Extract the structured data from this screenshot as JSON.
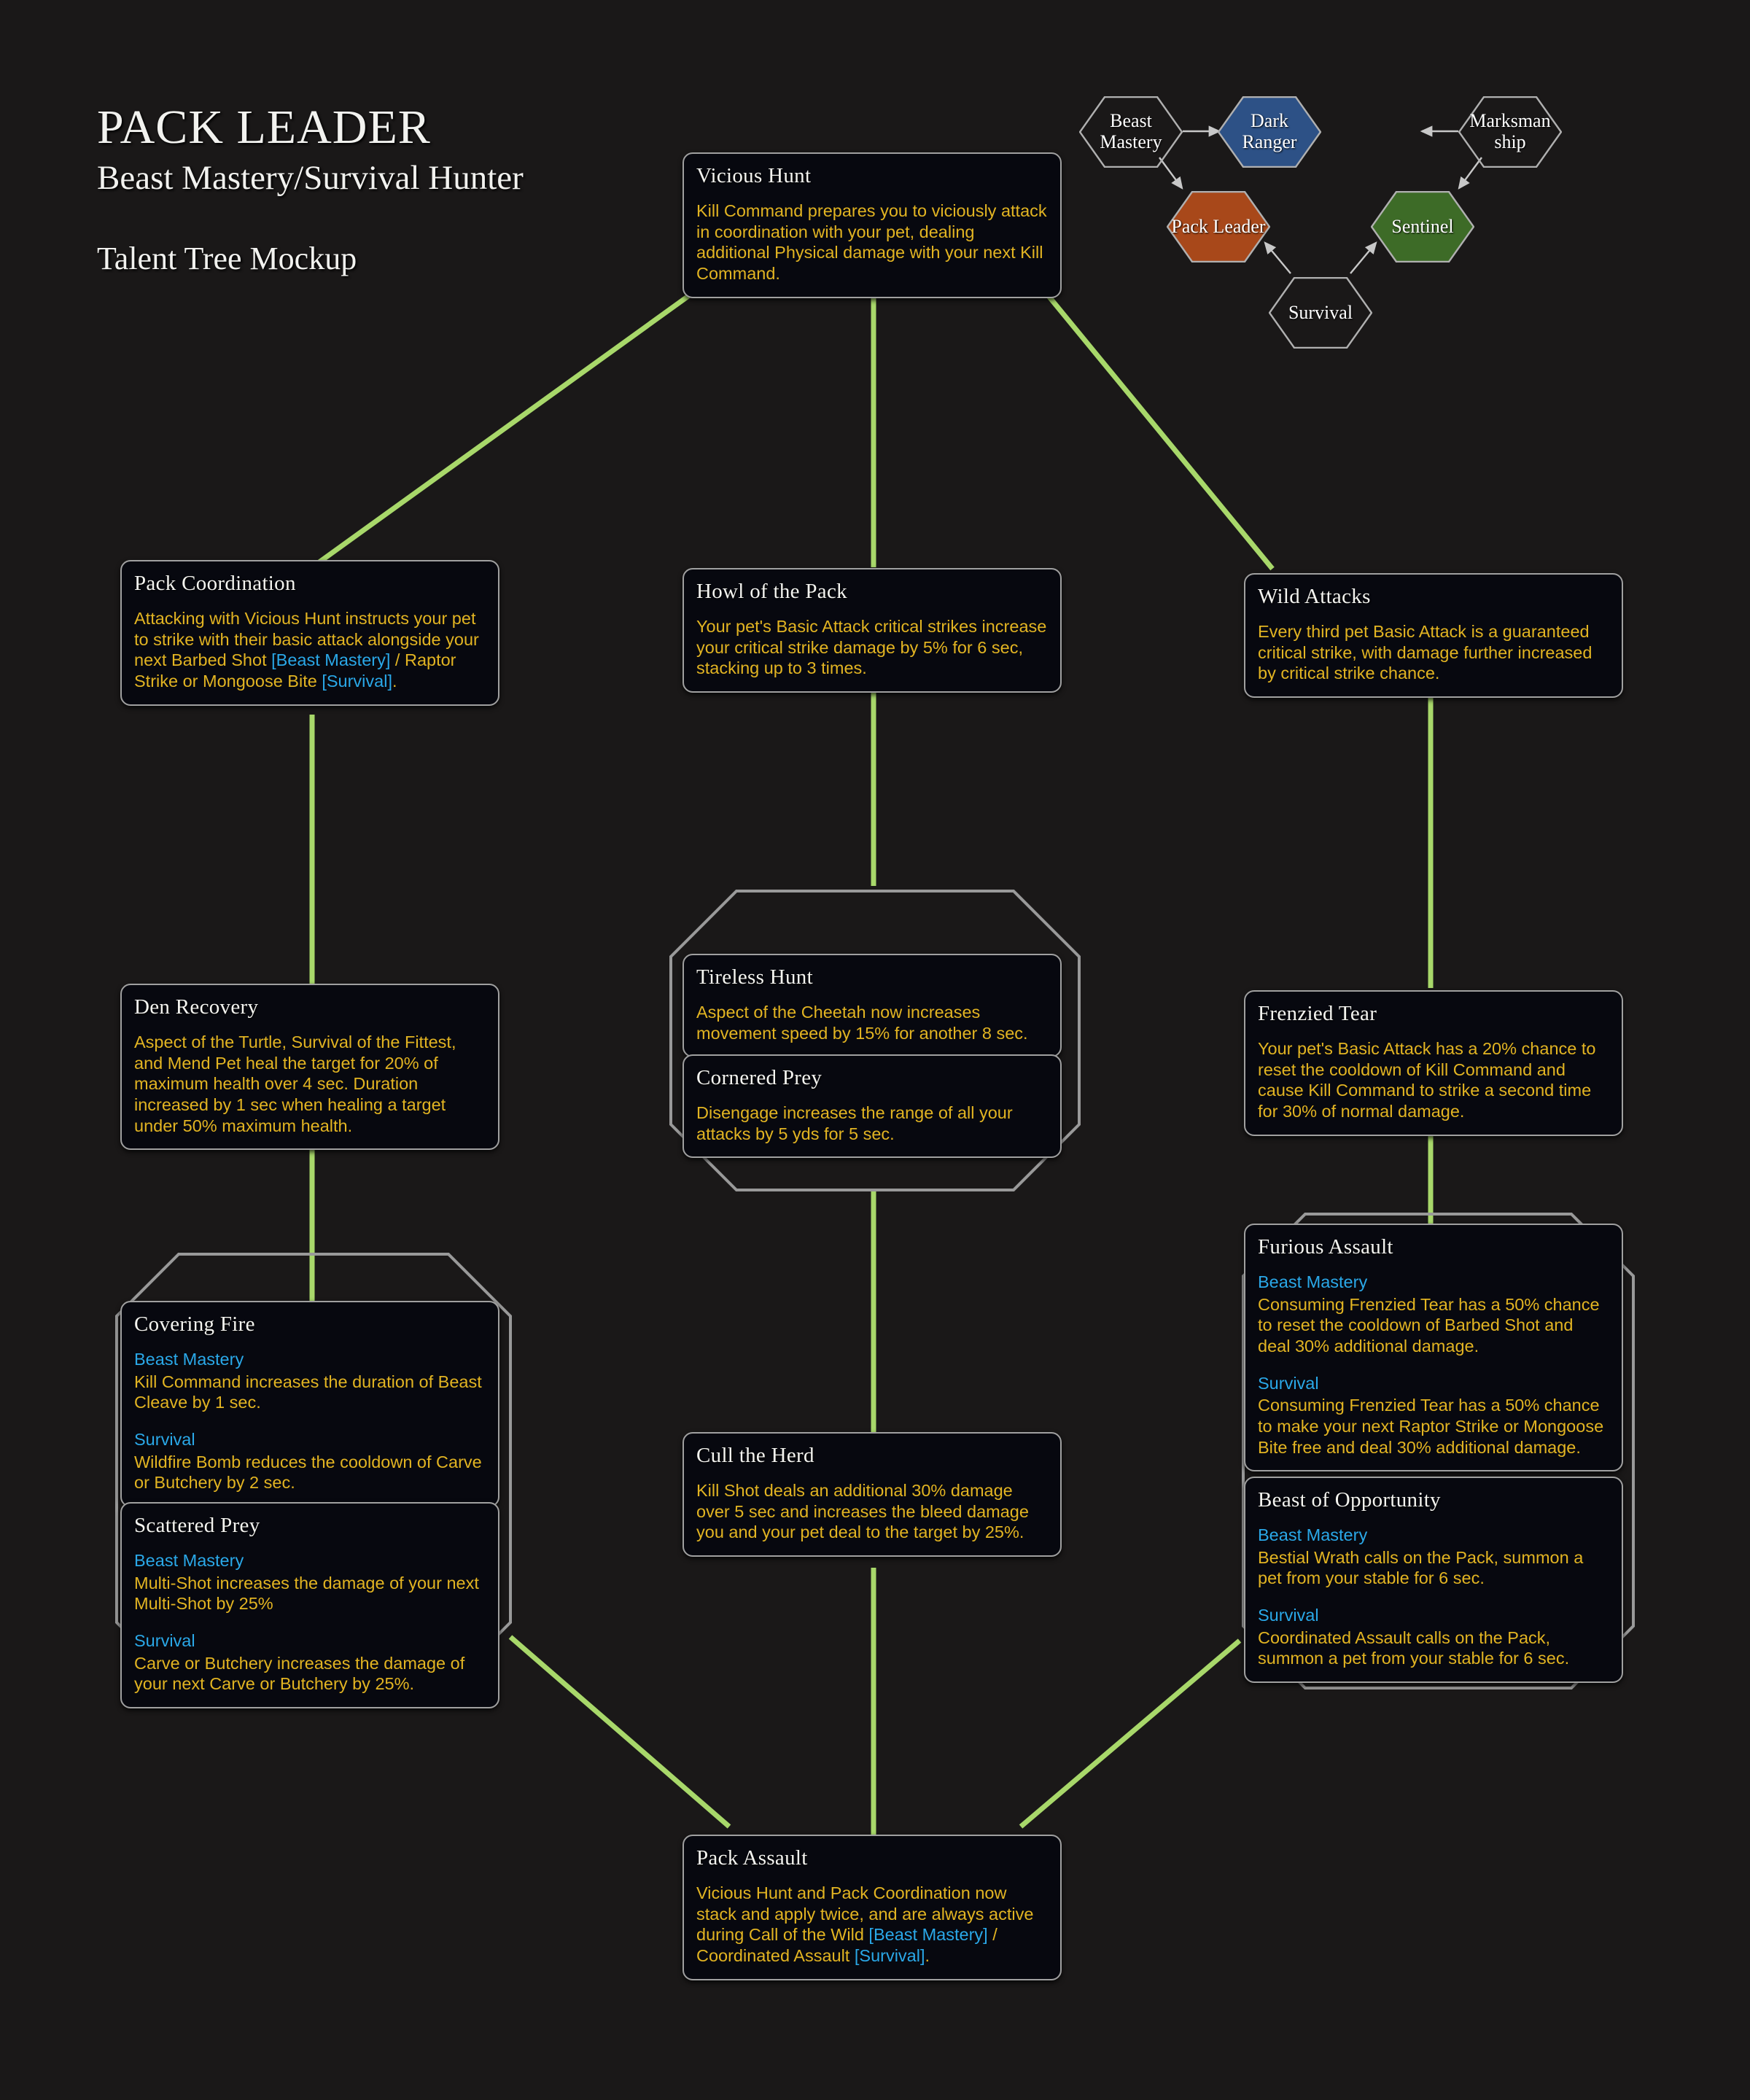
{
  "header": {
    "title": "PACK LEADER",
    "subtitle": "Beast Mastery/Survival Hunter",
    "caption": "Talent Tree Mockup"
  },
  "colors": {
    "background": "#1a1818",
    "node_bg": "#07080f",
    "node_border": "#a0a0a0",
    "connector": "#a8d86a",
    "desc_text": "#e2b422",
    "spec_text": "#2aa8e8",
    "title_text": "#f4f4f0",
    "hex_dark_ranger": "#2d5186",
    "hex_pack_leader": "#a8481a",
    "hex_sentinel": "#3d6b27",
    "hex_outline": "#b0b0b0"
  },
  "spec_map": {
    "nodes": [
      {
        "id": "beast-mastery",
        "label": "Beast Mastery",
        "fill": "none"
      },
      {
        "id": "dark-ranger",
        "label": "Dark Ranger",
        "fill": "#2d5186"
      },
      {
        "id": "marksmanship",
        "label": "Marksman ship",
        "fill": "none"
      },
      {
        "id": "pack-leader",
        "label": "Pack Leader",
        "fill": "#a8481a"
      },
      {
        "id": "sentinel",
        "label": "Sentinel",
        "fill": "#3d6b27"
      },
      {
        "id": "survival",
        "label": "Survival",
        "fill": "none"
      }
    ],
    "arrows": [
      {
        "from": "beast-mastery",
        "to": "dark-ranger"
      },
      {
        "from": "marksmanship",
        "to": "dark-ranger"
      },
      {
        "from": "beast-mastery",
        "to": "pack-leader"
      },
      {
        "from": "marksmanship",
        "to": "sentinel"
      },
      {
        "from": "survival",
        "to": "pack-leader"
      },
      {
        "from": "survival",
        "to": "sentinel"
      }
    ]
  },
  "talents": {
    "vicious_hunt": {
      "title": "Vicious Hunt",
      "desc": "Kill Command prepares you to viciously attack in coordination with your pet, dealing additional Physical damage with your next Kill Command."
    },
    "pack_coordination": {
      "title": "Pack Coordination",
      "desc_pre": "Attacking with Vicious Hunt instructs your pet to strike with their basic attack alongside your next Barbed Shot ",
      "tag1": "[Beast Mastery]",
      "desc_mid": " / Raptor Strike or Mongoose Bite ",
      "tag2": "[Survival]",
      "desc_post": "."
    },
    "howl_of_the_pack": {
      "title": "Howl of the Pack",
      "desc": "Your pet's Basic Attack critical strikes increase your critical strike damage by 5% for 6 sec, stacking up to 3 times."
    },
    "wild_attacks": {
      "title": "Wild Attacks",
      "desc": "Every third pet Basic Attack is a guaranteed critical strike, with damage further increased by critical strike chance."
    },
    "den_recovery": {
      "title": "Den Recovery",
      "desc": "Aspect of the Turtle, Survival of the Fittest, and Mend Pet heal the target for 20% of maximum health over 4 sec. Duration increased by 1 sec when healing a target under 50% maximum health."
    },
    "tireless_hunt": {
      "title": "Tireless Hunt",
      "desc": "Aspect of the Cheetah now increases movement speed by 15% for another 8 sec."
    },
    "cornered_prey": {
      "title": "Cornered Prey",
      "desc": "Disengage increases the range of all your attacks by 5 yds for 5 sec."
    },
    "frenzied_tear": {
      "title": "Frenzied Tear",
      "desc": "Your pet's Basic Attack has a 20% chance to reset the cooldown of Kill Command and cause Kill Command to strike a second time for 30% of normal damage."
    },
    "covering_fire": {
      "title": "Covering Fire",
      "bm_label": "Beast Mastery",
      "bm_text": "Kill Command increases the duration of Beast Cleave by 1 sec.",
      "sv_label": "Survival",
      "sv_text": "Wildfire Bomb reduces the cooldown of Carve or Butchery by 2 sec."
    },
    "scattered_prey": {
      "title": "Scattered Prey",
      "bm_label": "Beast Mastery",
      "bm_text": "Multi-Shot increases the damage of your next Multi-Shot by 25%",
      "sv_label": "Survival",
      "sv_text": "Carve or Butchery increases the damage of your next Carve or Butchery by 25%."
    },
    "furious_assault": {
      "title": "Furious Assault",
      "bm_label": "Beast Mastery",
      "bm_text": "Consuming Frenzied Tear has a 50% chance to reset the cooldown of Barbed Shot and deal 30% additional damage.",
      "sv_label": "Survival",
      "sv_text": "Consuming Frenzied Tear has a 50% chance to make your next Raptor Strike or Mongoose Bite free and deal 30% additional damage."
    },
    "beast_of_opportunity": {
      "title": "Beast of Opportunity",
      "bm_label": "Beast Mastery",
      "bm_text": "Bestial Wrath calls on the Pack, summon a pet from your stable for 6 sec.",
      "sv_label": "Survival",
      "sv_text": "Coordinated Assault calls on the Pack, summon a pet from your stable for 6 sec."
    },
    "cull_the_herd": {
      "title": "Cull the Herd",
      "desc": "Kill Shot deals an additional 30% damage over 5 sec and increases the bleed damage you and your pet deal to the target by 25%."
    },
    "pack_assault": {
      "title": "Pack Assault",
      "desc_pre": "Vicious Hunt and Pack Coordination now stack and apply twice, and are always active during Call of the Wild ",
      "tag1": "[Beast Mastery]",
      "desc_mid": " / Coordinated Assault ",
      "tag2": "[Survival]",
      "desc_post": "."
    }
  }
}
